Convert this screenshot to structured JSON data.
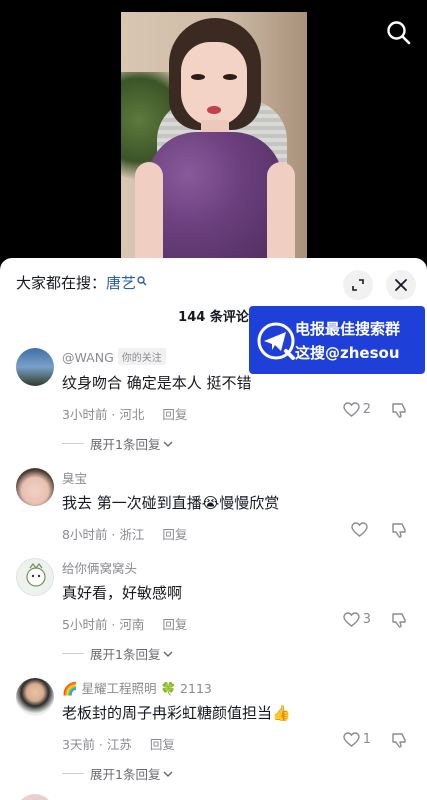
{
  "top_search_icon": "search-icon",
  "sheet": {
    "search_suggest_prefix": "大家都在搜：",
    "search_suggest_keyword": "唐艺",
    "comment_count": "144 条评论",
    "expand_icon": "expand-icon",
    "close_icon": "close-icon"
  },
  "banner": {
    "line1": "电报最佳搜索群",
    "line2": "这搜@zhesou"
  },
  "comments": [
    {
      "username": "@WANG",
      "tag": "你的关注",
      "text": "纹身吻合 确定是本人 挺不错",
      "time_location": "3小时前 · 河北",
      "reply_label": "回复",
      "likes": "2",
      "expand": "展开1条回复"
    },
    {
      "username": "臭宝",
      "text": "我去 第一次碰到直播😭慢慢欣赏",
      "time_location": "8小时前 · 浙江",
      "reply_label": "回复",
      "likes": ""
    },
    {
      "username": "给你俩窝窝头",
      "text": "真好看，好敏感啊",
      "time_location": "5小时前 · 河南",
      "reply_label": "回复",
      "likes": "3",
      "expand": "展开1条回复"
    },
    {
      "username": "🌈 星耀工程照明 🍀 2113",
      "text": "老板封的周子冉彩虹糖颜值担当👍",
      "time_location": "3天前 · 江苏",
      "reply_label": "回复",
      "likes": "1",
      "expand": "展开1条回复"
    }
  ]
}
